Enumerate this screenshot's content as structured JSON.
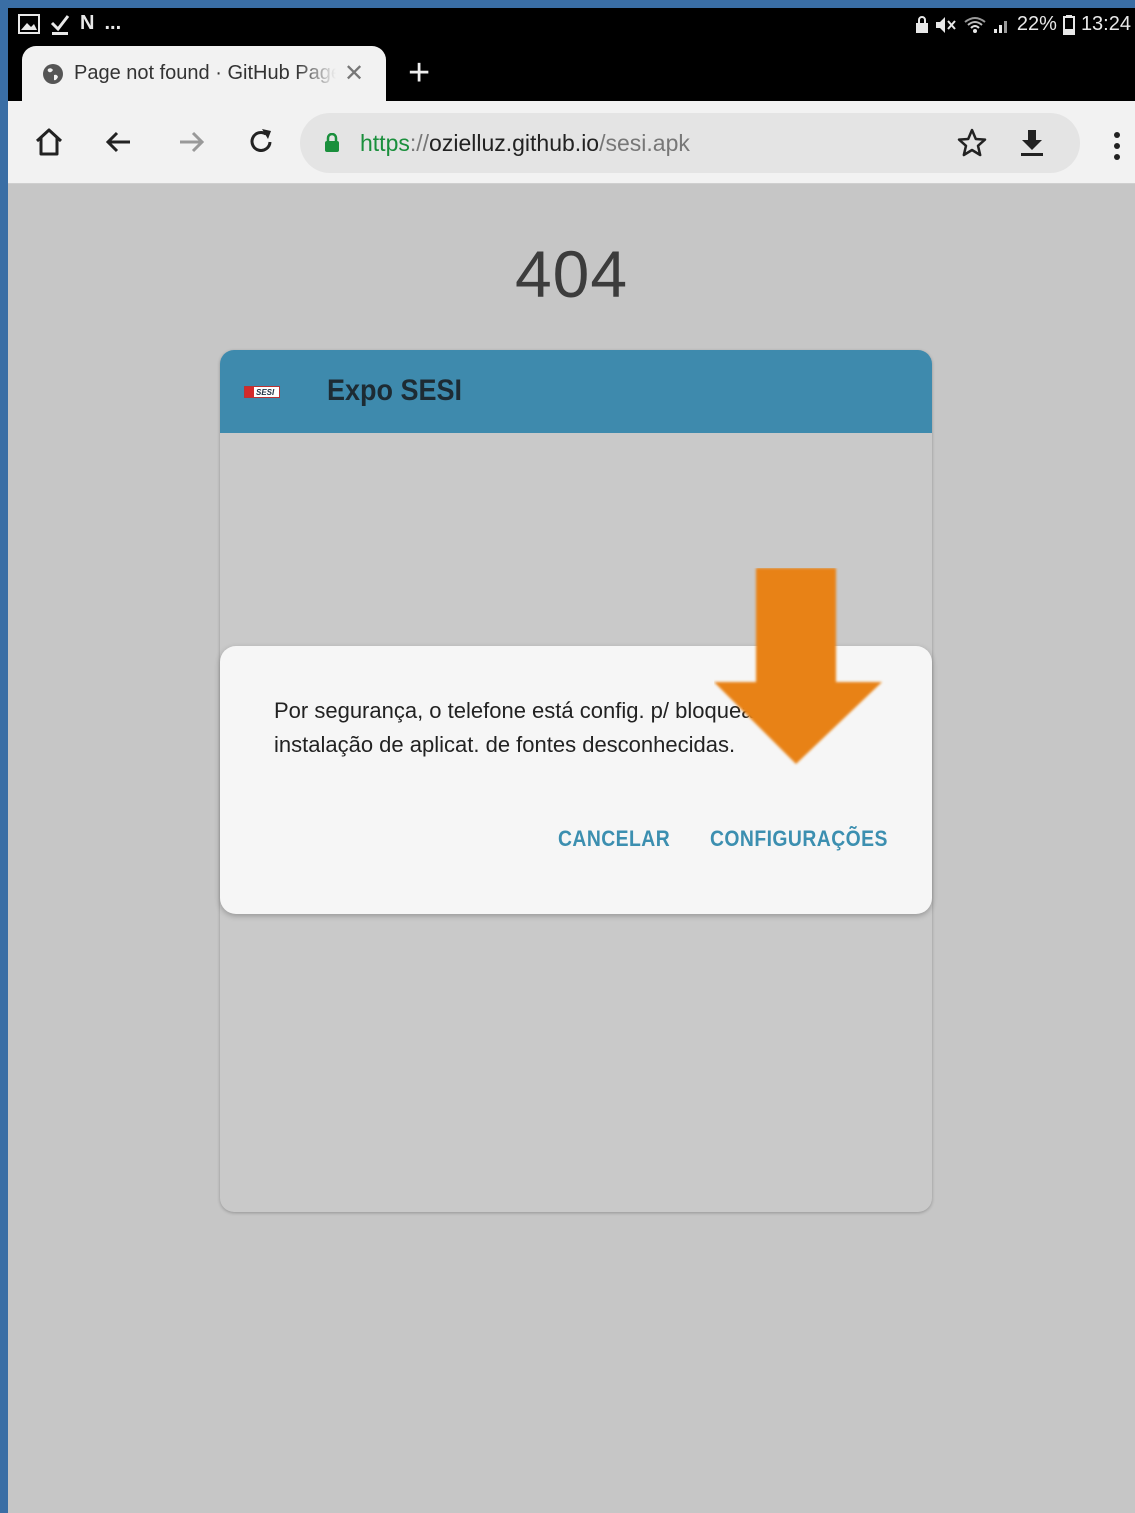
{
  "status_bar": {
    "left_icons": [
      "gallery-icon",
      "download-done-icon",
      "n-notification-icon"
    ],
    "overflow": "...",
    "battery_percent": "22%",
    "time": "13:24"
  },
  "tab": {
    "title": "Page not found · GitHub Pages",
    "close_glyph": "✕",
    "new_tab_glyph": "+"
  },
  "omnibox": {
    "url_scheme": "https",
    "url_sep": "://",
    "url_host": "ozielluz.github.io",
    "url_path": "/sesi.apk"
  },
  "page": {
    "error_code": "404"
  },
  "app": {
    "title": "Expo SESI",
    "logo_text": "SESI"
  },
  "dialog": {
    "message": "Por segurança, o telefone está config. p/ bloquear a instalação de aplicat. de fontes desconhecidas.",
    "cancel_label": "CANCELAR",
    "settings_label": "CONFIGURAÇÕES"
  },
  "colors": {
    "app_header": "#3e8aad",
    "dialog_button": "#3c8fb0",
    "annotation_arrow": "#e88214",
    "secure_lock": "#1a8f3c"
  }
}
